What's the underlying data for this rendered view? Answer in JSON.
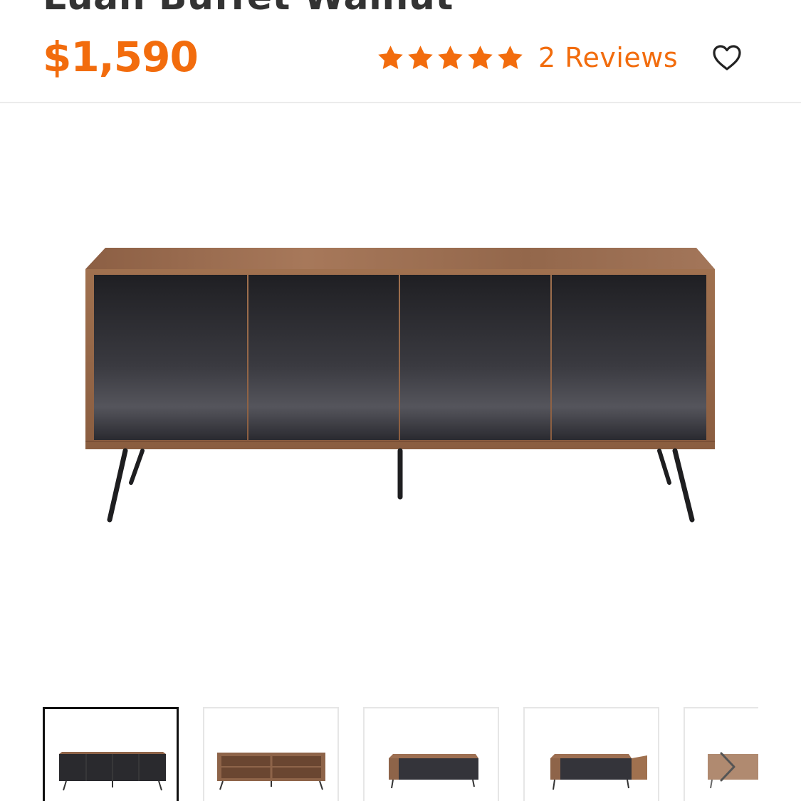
{
  "product": {
    "title": "Luan Buffet Walnut",
    "price": "$1,590",
    "rating": 5,
    "rating_max": 5,
    "reviews_label": "2 Reviews"
  },
  "colors": {
    "accent": "#f26c0d",
    "title_text": "#333333",
    "walnut": "#9a6a4a",
    "door_black": "#2a2a2e"
  },
  "icons": {
    "star": "star-icon",
    "favorite": "heart-icon",
    "next": "chevron-right-icon"
  },
  "gallery": {
    "active_index": 0,
    "thumbnails": [
      "front-closed",
      "front-open",
      "angled-closed",
      "angled-open",
      "side"
    ]
  }
}
